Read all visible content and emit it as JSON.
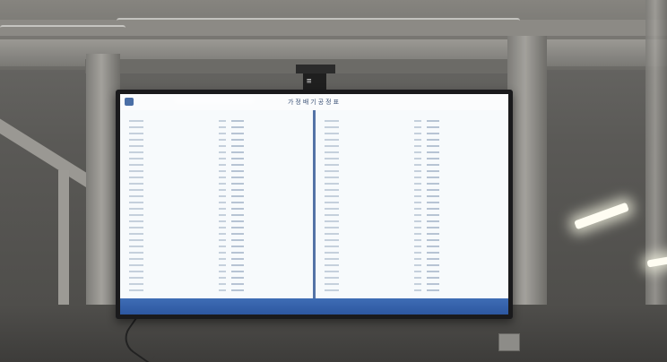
{
  "screen": {
    "title": "가정배기공정표",
    "colors": {
      "screen_bg": "#eef3f8",
      "header_accent": "#4b6fa6",
      "footer_blue": "#2d57a0",
      "divider": "#5473a7"
    },
    "rows_per_panel": 28
  },
  "scene": {
    "monitor_mount_logo": "≡"
  }
}
